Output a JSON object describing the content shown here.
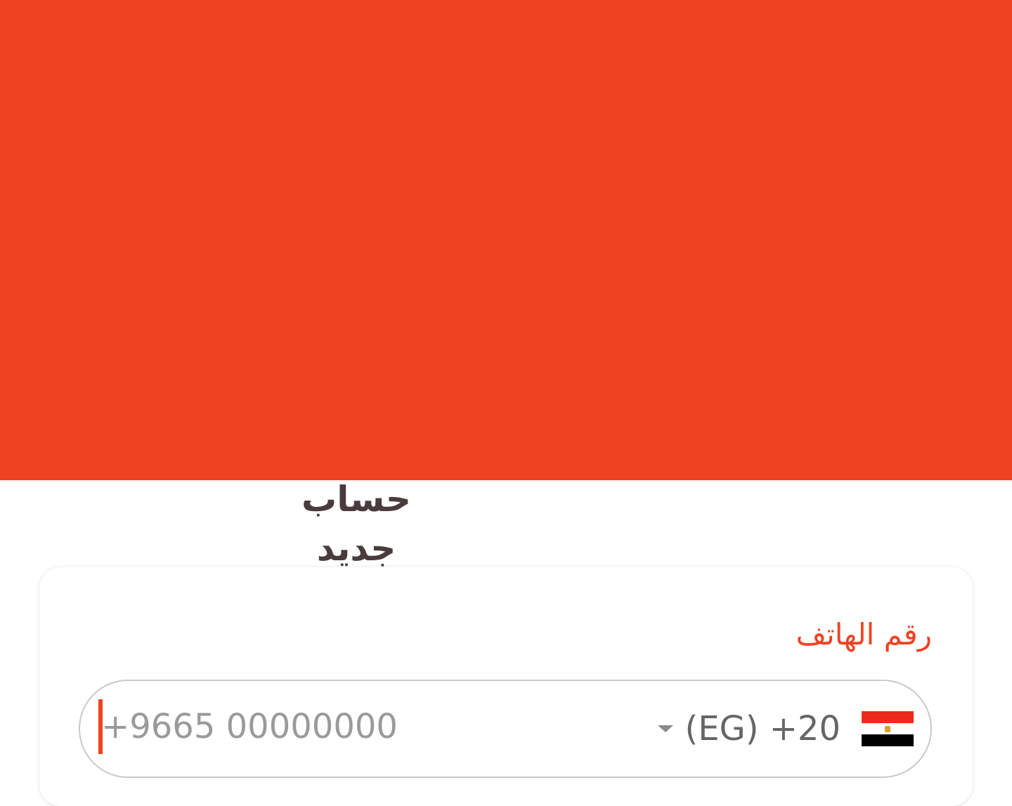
{
  "colors": {
    "brand": "#ee4323",
    "title_text": "#4a3c3c",
    "field_border": "#c9c9c9"
  },
  "header": {
    "title": "حساب جديد"
  },
  "form": {
    "phone_label": "رقم الهاتف",
    "phone_placeholder": "+9665 00000000",
    "country_code": "(EG) +20",
    "country_flag_icon": "egypt-flag-icon",
    "dropdown_icon": "caret-down-icon"
  }
}
